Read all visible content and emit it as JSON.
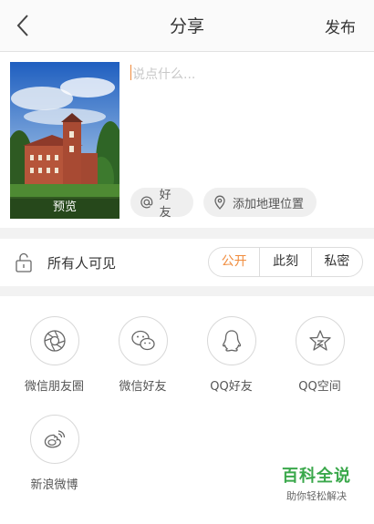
{
  "header": {
    "title": "分享",
    "publish_label": "发布"
  },
  "compose": {
    "placeholder": "说点什么...",
    "preview_label": "预览",
    "friend_chip": "好友",
    "location_chip": "添加地理位置"
  },
  "privacy": {
    "label": "所有人可见",
    "options": [
      "公开",
      "此刻",
      "私密"
    ],
    "selected": "公开"
  },
  "share_targets": [
    {
      "label": "微信朋友圈",
      "icon": "wechat-moments-icon"
    },
    {
      "label": "微信好友",
      "icon": "wechat-icon"
    },
    {
      "label": "QQ好友",
      "icon": "qq-icon"
    },
    {
      "label": "QQ空间",
      "icon": "qzone-icon"
    },
    {
      "label": "新浪微博",
      "icon": "weibo-icon"
    }
  ],
  "watermark": {
    "title": "百科全说",
    "subtitle": "助你轻松解决"
  },
  "colors": {
    "accent": "#f08b3c",
    "watermark": "#3aa84b"
  }
}
